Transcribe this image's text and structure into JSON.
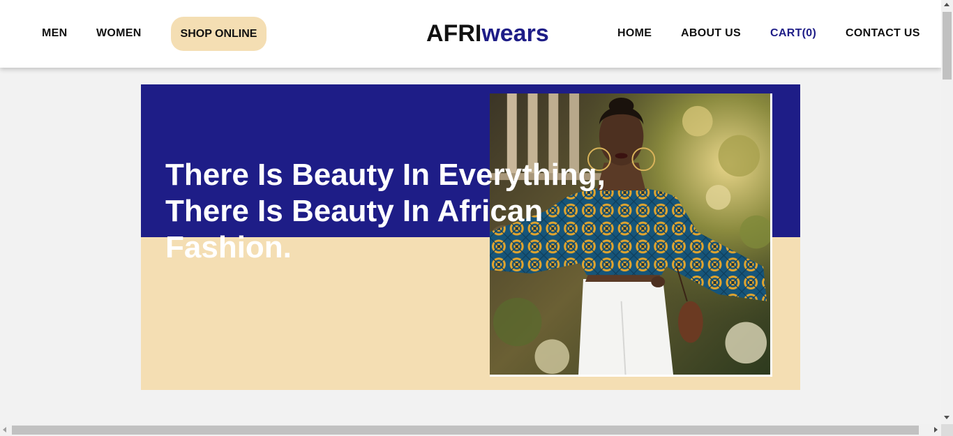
{
  "colors": {
    "navy": "#1e1d87",
    "cream": "#f4deb3",
    "pill_bg": "#f4deb3",
    "logo_dark": "#111111",
    "logo_accent": "#1e1d87",
    "cart_color": "#1e1d87"
  },
  "nav": {
    "left_links": [
      "MEN",
      "WOMEN"
    ],
    "shop_online": "SHOP ONLINE",
    "logo_part1": "AFRI",
    "logo_part2": "wears",
    "right_links": {
      "home": "HOME",
      "about": "ABOUT US",
      "cart": "CART(0)",
      "contact": "CONTACT US"
    }
  },
  "hero": {
    "heading_lines": [
      "There Is Beauty In Everything,",
      "There Is Beauty In African",
      "Fashion."
    ],
    "image_subject": "woman-in-african-print-top"
  }
}
